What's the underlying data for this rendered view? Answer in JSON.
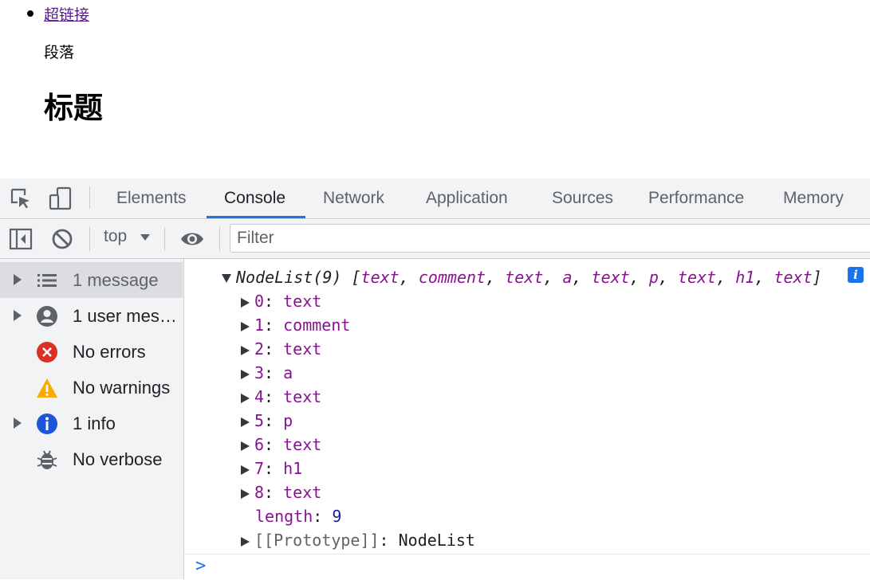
{
  "page": {
    "link_text": "超链接",
    "paragraph_text": "段落",
    "heading_text": "标题"
  },
  "devtools": {
    "tabs": [
      {
        "label": "Elements",
        "active": false
      },
      {
        "label": "Console",
        "active": true
      },
      {
        "label": "Network",
        "active": false
      },
      {
        "label": "Application",
        "active": false
      },
      {
        "label": "Sources",
        "active": false
      },
      {
        "label": "Performance",
        "active": false
      },
      {
        "label": "Memory",
        "active": false
      }
    ],
    "toolbar": {
      "context": "top",
      "filter_placeholder": "Filter"
    },
    "sidebar": [
      {
        "label": "1 message",
        "icon": "list-icon",
        "expandable": true,
        "selected": true
      },
      {
        "label": "1 user mess…",
        "icon": "user-icon",
        "expandable": true,
        "selected": false
      },
      {
        "label": "No errors",
        "icon": "error-icon",
        "expandable": false,
        "selected": false
      },
      {
        "label": "No warnings",
        "icon": "warning-icon",
        "expandable": false,
        "selected": false
      },
      {
        "label": "1 info",
        "icon": "info-icon",
        "expandable": true,
        "selected": false
      },
      {
        "label": "No verbose",
        "icon": "bug-icon",
        "expandable": false,
        "selected": false
      }
    ],
    "console": {
      "summary_name": "NodeList(9)",
      "summary_items": [
        "text",
        "comment",
        "text",
        "a",
        "text",
        "p",
        "text",
        "h1",
        "text"
      ],
      "entries": [
        {
          "index": "0",
          "value": "text"
        },
        {
          "index": "1",
          "value": "comment"
        },
        {
          "index": "2",
          "value": "text"
        },
        {
          "index": "3",
          "value": "a"
        },
        {
          "index": "4",
          "value": "text"
        },
        {
          "index": "5",
          "value": "p"
        },
        {
          "index": "6",
          "value": "text"
        },
        {
          "index": "7",
          "value": "h1"
        },
        {
          "index": "8",
          "value": "text"
        }
      ],
      "length_key": "length",
      "length_value": "9",
      "prototype_key": "[[Prototype]]",
      "prototype_value": "NodeList",
      "prompt": ">"
    },
    "colors": {
      "accent": "#1a73e8",
      "panel_bg": "#f1f3f4",
      "error": "#d93025",
      "warning": "#f9ab00",
      "key_purple": "#881391"
    }
  }
}
